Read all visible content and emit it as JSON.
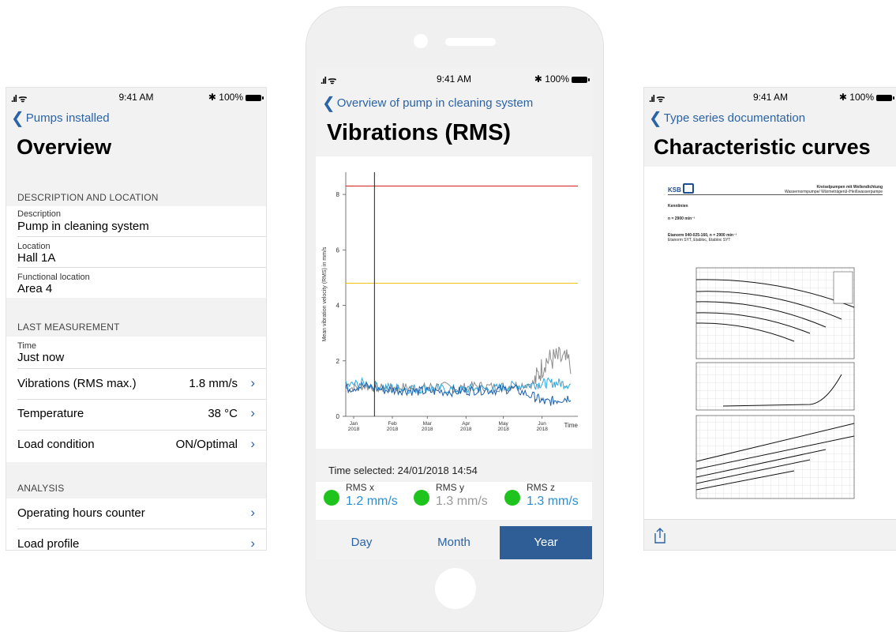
{
  "status": {
    "time": "9:41 AM",
    "battery": "100%"
  },
  "left": {
    "back": "Pumps installed",
    "title": "Overview",
    "sections": [
      {
        "header": "DESCRIPTION AND LOCATION"
      },
      {
        "header": "LAST MEASUREMENT"
      },
      {
        "header": "ANALYSIS"
      }
    ],
    "fields": [
      {
        "label": "Description",
        "value": "Pump in cleaning system"
      },
      {
        "label": "Location",
        "value": "Hall 1A"
      },
      {
        "label": "Functional location",
        "value": "Area 4"
      },
      {
        "label": "Time",
        "value": "Just now"
      }
    ],
    "rows": [
      {
        "label": "Vibrations (RMS max.)",
        "value": "1.8 mm/s"
      },
      {
        "label": "Temperature",
        "value": "38 °C"
      },
      {
        "label": "Load condition",
        "value": "ON/Optimal"
      },
      {
        "label": "Operating hours counter"
      },
      {
        "label": "Load profile"
      }
    ]
  },
  "middle": {
    "back": "Overview of pump in cleaning system",
    "title": "Vibrations (RMS)",
    "time_selected": "Time selected: 24/01/2018 14:54",
    "rms": [
      {
        "label": "RMS x",
        "value": "1.2 mm/s",
        "color": "#2b8fd0"
      },
      {
        "label": "RMS y",
        "value": "1.3 mm/s",
        "color": "#999999"
      },
      {
        "label": "RMS z",
        "value": "1.3 mm/s",
        "color": "#2b8fd0"
      }
    ],
    "tabs": [
      "Day",
      "Month",
      "Year"
    ],
    "active_tab": "Year"
  },
  "chart_data": {
    "type": "line",
    "title": "",
    "xlabel": "Time",
    "ylabel": "Mean vibration velocity (RMS) in mm/s",
    "ylim": [
      0,
      8.8
    ],
    "yticks": [
      "0",
      "2",
      "4",
      "6",
      "8"
    ],
    "x_ticks": [
      {
        "month": "Jan",
        "year": "2018"
      },
      {
        "month": "Feb",
        "year": "2018"
      },
      {
        "month": "Mar",
        "year": "2018"
      },
      {
        "month": "Apr",
        "year": "2018"
      },
      {
        "month": "May",
        "year": "2018"
      },
      {
        "month": "Jun",
        "year": "2018"
      }
    ],
    "thresholds": [
      {
        "value": 8.3,
        "color": "#d62020"
      },
      {
        "value": 4.8,
        "color": "#f0c419"
      }
    ],
    "cursor_date": "24/01/2018",
    "series": [
      {
        "color": "#8c8c8c",
        "x": [
          "2018-01-01",
          "2018-01-15",
          "2018-02-01",
          "2018-02-15",
          "2018-03-01",
          "2018-03-15",
          "2018-04-01",
          "2018-04-15",
          "2018-05-01",
          "2018-05-15",
          "2018-06-01",
          "2018-06-10",
          "2018-06-20",
          "2018-07-01"
        ],
        "y": [
          1.0,
          1.1,
          1.0,
          1.05,
          1.0,
          1.1,
          1.0,
          1.1,
          1.05,
          1.1,
          1.2,
          2.0,
          2.1,
          1.9
        ]
      },
      {
        "color": "#2ba6e0",
        "x": [
          "2018-01-01",
          "2018-01-15",
          "2018-02-01",
          "2018-02-15",
          "2018-03-01",
          "2018-03-15",
          "2018-04-01",
          "2018-04-15",
          "2018-05-01",
          "2018-05-15",
          "2018-06-01",
          "2018-06-10",
          "2018-06-20",
          "2018-07-01"
        ],
        "y": [
          1.1,
          1.2,
          1.05,
          1.0,
          1.0,
          1.0,
          0.95,
          1.0,
          1.0,
          1.1,
          1.15,
          1.2,
          1.2,
          1.15
        ]
      },
      {
        "color": "#1e5fa8",
        "x": [
          "2018-01-01",
          "2018-01-15",
          "2018-02-01",
          "2018-02-15",
          "2018-03-01",
          "2018-03-15",
          "2018-04-01",
          "2018-04-15",
          "2018-05-01",
          "2018-05-15",
          "2018-06-01",
          "2018-06-10",
          "2018-06-20",
          "2018-07-01"
        ],
        "y": [
          1.0,
          1.1,
          0.95,
          0.95,
          0.9,
          0.9,
          0.9,
          0.95,
          0.95,
          1.0,
          0.7,
          0.5,
          0.6,
          0.7
        ]
      }
    ]
  },
  "right": {
    "back": "Type series documentation",
    "title": "Characteristic curves",
    "doc": {
      "logo": "KSB",
      "heading1": "Kreiselpumpen mit Wellendichtung",
      "heading2": "Wassernormpumpe/ Wärmeträgerül-/Heißwasserpumpe",
      "section": "Kennlinien",
      "speed": "n = 2900 min⁻¹",
      "model": "Etanorm 040-025-160, n = 2900 min⁻¹",
      "model_sub": "Etanorm SYT, Etabloc, Etabloc SYT"
    },
    "share_icon": "share-icon"
  }
}
